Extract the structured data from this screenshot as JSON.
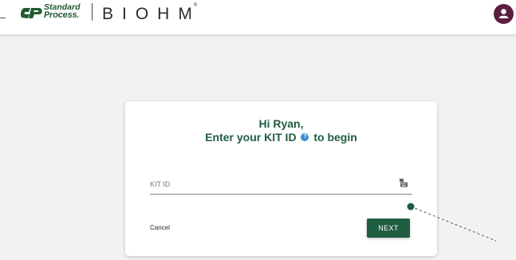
{
  "header": {
    "brand_line1": "Standard",
    "brand_line2": "Process.",
    "product": "BIOHM",
    "product_mark": "®"
  },
  "card": {
    "greeting": "Hi Ryan,",
    "prompt_before": "Enter your KIT ID",
    "prompt_after": "to begin",
    "help_icon": "question-circle-icon",
    "field": {
      "placeholder": "KIT ID",
      "value": "",
      "icon": "keyboard-icon"
    },
    "cancel_label": "Cancel",
    "next_label": "NEXT"
  },
  "colors": {
    "brand_green": "#1f5d41",
    "avatar_bg": "#5a1f3f",
    "help_blue": "#3b8fd1",
    "page_bg": "#f2f2f2"
  }
}
